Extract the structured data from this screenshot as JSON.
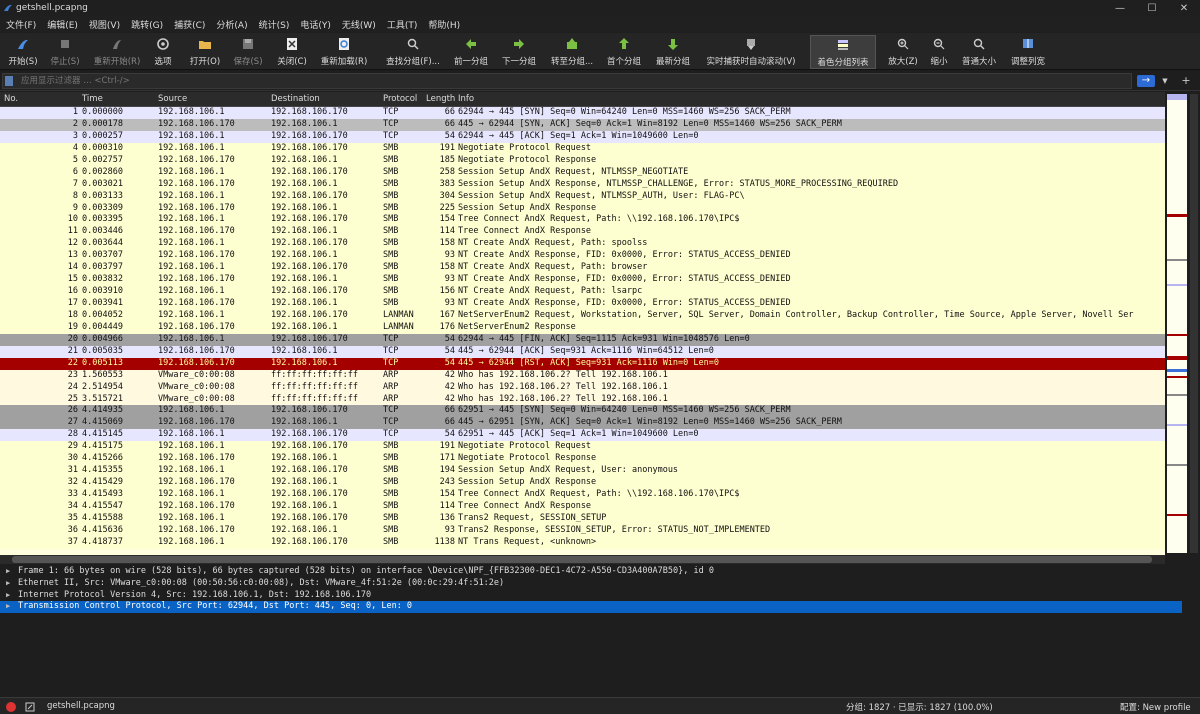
{
  "window": {
    "title": "getshell.pcapng"
  },
  "menu": [
    "文件(F)",
    "编辑(E)",
    "视图(V)",
    "跳转(G)",
    "捕获(C)",
    "分析(A)",
    "统计(S)",
    "电话(Y)",
    "无线(W)",
    "工具(T)",
    "帮助(H)"
  ],
  "toolbar": {
    "buttons": [
      {
        "label": "开始(S)",
        "icon": "shark-fin-icon",
        "disabled": false
      },
      {
        "label": "停止(S)",
        "icon": "stop-icon",
        "disabled": true
      },
      {
        "label": "重新开始(R)",
        "icon": "restart-icon",
        "disabled": true
      },
      {
        "label": "选项",
        "icon": "gear-icon",
        "disabled": false
      },
      {
        "label": "打开(O)",
        "icon": "folder-icon",
        "disabled": false
      },
      {
        "label": "保存(S)",
        "icon": "save-icon",
        "disabled": true
      },
      {
        "label": "关闭(C)",
        "icon": "close-file-icon",
        "disabled": false
      },
      {
        "label": "重新加载(R)",
        "icon": "reload-icon",
        "disabled": false
      },
      {
        "label": "查找分组(F)...",
        "icon": "search-icon",
        "disabled": false
      },
      {
        "label": "前一分组",
        "icon": "arrow-left-icon",
        "disabled": false
      },
      {
        "label": "下一分组",
        "icon": "arrow-right-icon",
        "disabled": false
      },
      {
        "label": "转至分组...",
        "icon": "goto-icon",
        "disabled": false
      },
      {
        "label": "首个分组",
        "icon": "arrow-up-icon",
        "disabled": false
      },
      {
        "label": "最新分组",
        "icon": "arrow-down-icon",
        "disabled": false
      },
      {
        "label": "实时捕获时自动滚动(V)",
        "icon": "autoscroll-icon",
        "disabled": false
      },
      {
        "label": "着色分组列表",
        "icon": "colorize-icon",
        "disabled": false
      },
      {
        "label": "放大(Z)",
        "icon": "zoom-in-icon",
        "disabled": false
      },
      {
        "label": "缩小",
        "icon": "zoom-out-icon",
        "disabled": false
      },
      {
        "label": "普通大小",
        "icon": "zoom-reset-icon",
        "disabled": false
      },
      {
        "label": "调整列宽",
        "icon": "resize-columns-icon",
        "disabled": false
      }
    ]
  },
  "filter": {
    "placeholder": "应用显示过滤器 … <Ctrl-/>"
  },
  "packet_list": {
    "columns": [
      "No.",
      "Time",
      "Source",
      "Destination",
      "Protocol",
      "Length",
      "Info"
    ],
    "rows": [
      [
        "1",
        "0.000000",
        "192.168.106.1",
        "192.168.106.170",
        "TCP",
        "66",
        "62944 → 445 [SYN] Seq=0 Win=64240 Len=0 MSS=1460 WS=256 SACK_PERM",
        "tcp"
      ],
      [
        "2",
        "0.000178",
        "192.168.106.170",
        "192.168.106.1",
        "TCP",
        "66",
        "445 → 62944 [SYN, ACK] Seq=0 Ack=1 Win=8192 Len=0 MSS=1460 WS=256 SACK_PERM",
        "sel-cur"
      ],
      [
        "3",
        "0.000257",
        "192.168.106.1",
        "192.168.106.170",
        "TCP",
        "54",
        "62944 → 445 [ACK] Seq=1 Ack=1 Win=1049600 Len=0",
        "tcp"
      ],
      [
        "4",
        "0.000310",
        "192.168.106.1",
        "192.168.106.170",
        "SMB",
        "191",
        "Negotiate Protocol Request",
        "smb"
      ],
      [
        "5",
        "0.002757",
        "192.168.106.170",
        "192.168.106.1",
        "SMB",
        "185",
        "Negotiate Protocol Response",
        "smb"
      ],
      [
        "6",
        "0.002860",
        "192.168.106.1",
        "192.168.106.170",
        "SMB",
        "258",
        "Session Setup AndX Request, NTLMSSP_NEGOTIATE",
        "smb"
      ],
      [
        "7",
        "0.003021",
        "192.168.106.170",
        "192.168.106.1",
        "SMB",
        "383",
        "Session Setup AndX Response, NTLMSSP_CHALLENGE, Error: STATUS_MORE_PROCESSING_REQUIRED",
        "smb"
      ],
      [
        "8",
        "0.003133",
        "192.168.106.1",
        "192.168.106.170",
        "SMB",
        "304",
        "Session Setup AndX Request, NTLMSSP_AUTH, User: FLAG-PC\\",
        "smb"
      ],
      [
        "9",
        "0.003309",
        "192.168.106.170",
        "192.168.106.1",
        "SMB",
        "225",
        "Session Setup AndX Response",
        "smb"
      ],
      [
        "10",
        "0.003395",
        "192.168.106.1",
        "192.168.106.170",
        "SMB",
        "154",
        "Tree Connect AndX Request, Path: \\\\192.168.106.170\\IPC$",
        "smb"
      ],
      [
        "11",
        "0.003446",
        "192.168.106.170",
        "192.168.106.1",
        "SMB",
        "114",
        "Tree Connect AndX Response",
        "smb"
      ],
      [
        "12",
        "0.003644",
        "192.168.106.1",
        "192.168.106.170",
        "SMB",
        "158",
        "NT Create AndX Request, Path: spoolss",
        "smb"
      ],
      [
        "13",
        "0.003707",
        "192.168.106.170",
        "192.168.106.1",
        "SMB",
        "93",
        "NT Create AndX Response, FID: 0x0000, Error: STATUS_ACCESS_DENIED",
        "smb"
      ],
      [
        "14",
        "0.003797",
        "192.168.106.1",
        "192.168.106.170",
        "SMB",
        "158",
        "NT Create AndX Request, Path: browser",
        "smb"
      ],
      [
        "15",
        "0.003832",
        "192.168.106.170",
        "192.168.106.1",
        "SMB",
        "93",
        "NT Create AndX Response, FID: 0x0000, Error: STATUS_ACCESS_DENIED",
        "smb"
      ],
      [
        "16",
        "0.003910",
        "192.168.106.1",
        "192.168.106.170",
        "SMB",
        "156",
        "NT Create AndX Request, Path: lsarpc",
        "smb"
      ],
      [
        "17",
        "0.003941",
        "192.168.106.170",
        "192.168.106.1",
        "SMB",
        "93",
        "NT Create AndX Response, FID: 0x0000, Error: STATUS_ACCESS_DENIED",
        "smb"
      ],
      [
        "18",
        "0.004052",
        "192.168.106.1",
        "192.168.106.170",
        "LANMAN",
        "167",
        "NetServerEnum2 Request, Workstation, Server, SQL Server, Domain Controller, Backup Controller, Time Source, Apple Server, Novell Ser",
        "smb"
      ],
      [
        "19",
        "0.004449",
        "192.168.106.170",
        "192.168.106.1",
        "LANMAN",
        "176",
        "NetServerEnum2 Response",
        "smb"
      ],
      [
        "20",
        "0.004966",
        "192.168.106.1",
        "192.168.106.170",
        "TCP",
        "54",
        "62944 → 445 [FIN, ACK] Seq=1115 Ack=931 Win=1048576 Len=0",
        "tcp-gray"
      ],
      [
        "21",
        "0.005035",
        "192.168.106.170",
        "192.168.106.1",
        "TCP",
        "54",
        "445 → 62944 [ACK] Seq=931 Ack=1116 Win=64512 Len=0",
        "tcp"
      ],
      [
        "22",
        "0.005113",
        "192.168.106.170",
        "192.168.106.1",
        "TCP",
        "54",
        "445 → 62944 [RST, ACK] Seq=931 Ack=1116 Win=0 Len=0",
        "rst"
      ],
      [
        "23",
        "1.560553",
        "VMware_c0:00:08",
        "ff:ff:ff:ff:ff:ff",
        "ARP",
        "42",
        "Who has 192.168.106.2? Tell 192.168.106.1",
        "arp"
      ],
      [
        "24",
        "2.514954",
        "VMware_c0:00:08",
        "ff:ff:ff:ff:ff:ff",
        "ARP",
        "42",
        "Who has 192.168.106.2? Tell 192.168.106.1",
        "arp"
      ],
      [
        "25",
        "3.515721",
        "VMware_c0:00:08",
        "ff:ff:ff:ff:ff:ff",
        "ARP",
        "42",
        "Who has 192.168.106.2? Tell 192.168.106.1",
        "arp"
      ],
      [
        "26",
        "4.414935",
        "192.168.106.1",
        "192.168.106.170",
        "TCP",
        "66",
        "62951 → 445 [SYN] Seq=0 Win=64240 Len=0 MSS=1460 WS=256 SACK_PERM",
        "tcp-gray"
      ],
      [
        "27",
        "4.415069",
        "192.168.106.170",
        "192.168.106.1",
        "TCP",
        "66",
        "445 → 62951 [SYN, ACK] Seq=0 Ack=1 Win=8192 Len=0 MSS=1460 WS=256 SACK_PERM",
        "tcp-gray"
      ],
      [
        "28",
        "4.415145",
        "192.168.106.1",
        "192.168.106.170",
        "TCP",
        "54",
        "62951 → 445 [ACK] Seq=1 Ack=1 Win=1049600 Len=0",
        "tcp"
      ],
      [
        "29",
        "4.415175",
        "192.168.106.1",
        "192.168.106.170",
        "SMB",
        "191",
        "Negotiate Protocol Request",
        "smb"
      ],
      [
        "30",
        "4.415266",
        "192.168.106.170",
        "192.168.106.1",
        "SMB",
        "171",
        "Negotiate Protocol Response",
        "smb"
      ],
      [
        "31",
        "4.415355",
        "192.168.106.1",
        "192.168.106.170",
        "SMB",
        "194",
        "Session Setup AndX Request, User: anonymous",
        "smb"
      ],
      [
        "32",
        "4.415429",
        "192.168.106.170",
        "192.168.106.1",
        "SMB",
        "243",
        "Session Setup AndX Response",
        "smb"
      ],
      [
        "33",
        "4.415493",
        "192.168.106.1",
        "192.168.106.170",
        "SMB",
        "154",
        "Tree Connect AndX Request, Path: \\\\192.168.106.170\\IPC$",
        "smb"
      ],
      [
        "34",
        "4.415547",
        "192.168.106.170",
        "192.168.106.1",
        "SMB",
        "114",
        "Tree Connect AndX Response",
        "smb"
      ],
      [
        "35",
        "4.415588",
        "192.168.106.1",
        "192.168.106.170",
        "SMB",
        "136",
        "Trans2 Request, SESSION_SETUP",
        "smb"
      ],
      [
        "36",
        "4.415636",
        "192.168.106.170",
        "192.168.106.1",
        "SMB",
        "93",
        "Trans2 Response, SESSION_SETUP, Error: STATUS_NOT_IMPLEMENTED",
        "smb"
      ],
      [
        "37",
        "4.418737",
        "192.168.106.1",
        "192.168.106.170",
        "SMB",
        "1138",
        "NT Trans Request, <unknown>",
        "smb"
      ]
    ]
  },
  "details": [
    {
      "text": "Frame 1: 66 bytes on wire (528 bits), 66 bytes captured (528 bits) on interface \\Device\\NPF_{FFB32300-DEC1-4C72-A550-CD3A400A7B50}, id 0",
      "selected": false
    },
    {
      "text": "Ethernet II, Src: VMware_c0:00:08 (00:50:56:c0:00:08), Dst: VMware_4f:51:2e (00:0c:29:4f:51:2e)",
      "selected": false
    },
    {
      "text": "Internet Protocol Version 4, Src: 192.168.106.1, Dst: 192.168.106.170",
      "selected": false
    },
    {
      "text": "Transmission Control Protocol, Src Port: 62944, Dst Port: 445, Seq: 0, Len: 0",
      "selected": true
    }
  ],
  "status": {
    "file": "getshell.pcapng",
    "counts": "分组: 1827 · 已显示: 1827 (100.0%)",
    "profile": "配置: New profile"
  },
  "colors": {
    "tcp": "#e7e6ff",
    "tcp_gray": "#a0a0a0",
    "rst_bg": "#a40000",
    "rst_fg": "#fffc9c",
    "smb": "#feffd0",
    "arp": "#fff9e0",
    "selected_detail": "#0a63c4"
  }
}
